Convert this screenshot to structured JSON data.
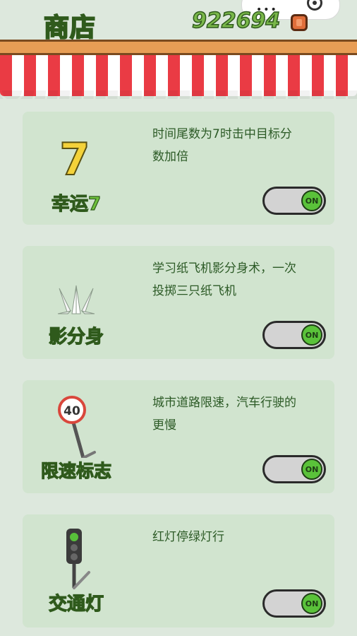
{
  "header": {
    "title": "商店",
    "coins": "922694"
  },
  "cards": [
    {
      "name": "幸运7",
      "desc_line1": "时间尾数为7时击中目标分",
      "desc_line2": "数加倍",
      "toggle": "ON"
    },
    {
      "name": "影分身",
      "desc_line1": "学习纸飞机影分身术，一次",
      "desc_line2": "投掷三只纸飞机",
      "toggle": "ON"
    },
    {
      "name": "限速标志",
      "desc_line1": "城市道路限速，汽车行驶的",
      "desc_line2": "更慢",
      "toggle": "ON",
      "sign_text": "40"
    },
    {
      "name": "交通灯",
      "desc_line1": "红灯停绿灯行",
      "desc_line2": "",
      "toggle": "ON"
    }
  ],
  "colors": {
    "accent_green": "#6ec03c",
    "awning_red": "#ea3b44",
    "card_bg": "#d1e4cf",
    "toggle_on": "#5ac23a"
  },
  "icons": [
    "lucky-seven-icon",
    "paper-plane-icon",
    "speed-limit-sign-icon",
    "traffic-light-icon",
    "coin-icon"
  ]
}
